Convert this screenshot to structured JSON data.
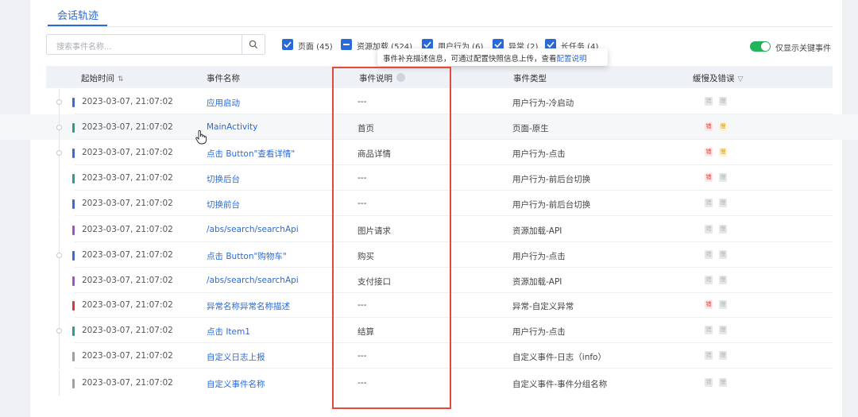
{
  "tab": {
    "label": "会话轨迹"
  },
  "search": {
    "placeholder": "搜索事件名称..."
  },
  "filters": [
    {
      "label": "页面 (45)",
      "checked": true
    },
    {
      "label": "资源加载 (524)",
      "checked": "partial"
    },
    {
      "label": "用户行为 (6)",
      "checked": true
    },
    {
      "label": "异常 (2)",
      "checked": true
    },
    {
      "label": "长任务 (4)",
      "checked": true
    }
  ],
  "toggle": {
    "label": "仅显示关键事件",
    "on": true
  },
  "tooltip": {
    "text": "事件补充描述信息，可通过配置快照信息上传，查看",
    "link": "配置说明"
  },
  "columns": {
    "time": "起始时间",
    "name": "事件名称",
    "desc": "事件说明",
    "type": "事件类型",
    "issues": "缓慢及错误"
  },
  "badge_labels": {
    "error": "错",
    "slow": "慢"
  },
  "colors": {
    "accent": "#2a6ad8",
    "highlight_box": "#e24a3b",
    "toggle_on": "#22b35b",
    "marker_blue": "#2f6fd6",
    "marker_teal": "#2a9d8f",
    "marker_purple": "#b04ac9",
    "marker_red": "#d63a3a",
    "marker_gray": "#9aa0a8"
  },
  "rows": [
    {
      "time": "2023-03-07, 21:07:02",
      "name": "应用启动",
      "desc": "---",
      "type": "用户行为-冷启动",
      "marker": "#2f6fd6",
      "node": true,
      "error": false,
      "slow": false
    },
    {
      "time": "2023-03-07, 21:07:02",
      "name": "MainActivity",
      "desc": "首页",
      "type": "页面-原生",
      "marker": "#2a9d8f",
      "node": true,
      "error": true,
      "slow": true
    },
    {
      "time": "2023-03-07, 21:07:02",
      "name": "点击 Button\"查看详情\"",
      "desc": "商品详情",
      "type": "用户行为-点击",
      "marker": "#2f6fd6",
      "node": true,
      "error": true,
      "slow": true
    },
    {
      "time": "2023-03-07, 21:07:02",
      "name": "切换后台",
      "desc": "---",
      "type": "用户行为-前后台切换",
      "marker": "#2a9d8f",
      "node": false,
      "error": true,
      "slow": false
    },
    {
      "time": "2023-03-07, 21:07:02",
      "name": "切换前台",
      "desc": "---",
      "type": "用户行为-前后台切换",
      "marker": "#2f6fd6",
      "node": false,
      "error": false,
      "slow": false
    },
    {
      "time": "2023-03-07, 21:07:02",
      "name": "/abs/search/searchApi",
      "desc": "图片请求",
      "type": "资源加载-API",
      "marker": "#b04ac9",
      "node": false,
      "error": false,
      "slow": false
    },
    {
      "time": "2023-03-07, 21:07:02",
      "name": "点击 Button\"购物车\"",
      "desc": "购买",
      "type": "用户行为-点击",
      "marker": "#2f6fd6",
      "node": true,
      "error": false,
      "slow": false
    },
    {
      "time": "2023-03-07, 21:07:02",
      "name": "/abs/search/searchApi",
      "desc": "支付接口",
      "type": "资源加载-API",
      "marker": "#b04ac9",
      "node": false,
      "error": false,
      "slow": false
    },
    {
      "time": "2023-03-07, 21:07:02",
      "name": "异常名称异常名称描述",
      "desc": "---",
      "type": "异常-自定义异常",
      "marker": "#d63a3a",
      "node": false,
      "error": true,
      "slow": false
    },
    {
      "time": "2023-03-07, 21:07:02",
      "name": "点击 Item1",
      "desc": "结算",
      "type": "用户行为-点击",
      "marker": "#2a9d8f",
      "node": true,
      "error": false,
      "slow": false
    },
    {
      "time": "2023-03-07, 21:07:02",
      "name": "自定义日志上报",
      "desc": "---",
      "type": "自定义事件-日志（info）",
      "marker": "#9aa0a8",
      "node": false,
      "error": false,
      "slow": false
    },
    {
      "time": "2023-03-07, 21:07:02",
      "name": "自定义事件名称",
      "desc": "---",
      "type": "自定义事件-事件分组名称",
      "marker": "#9aa0a8",
      "node": false,
      "error": false,
      "slow": false
    }
  ]
}
